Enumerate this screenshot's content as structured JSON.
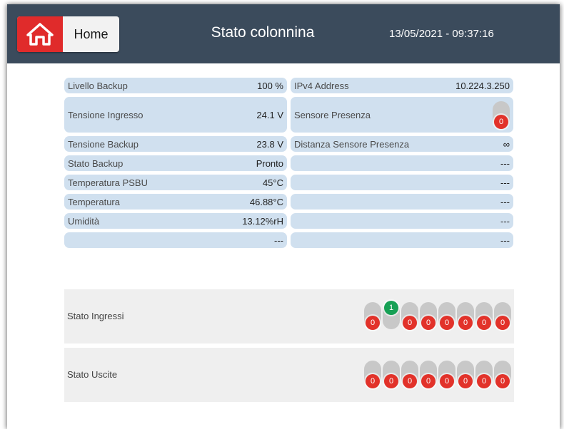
{
  "header": {
    "home_label": "Home",
    "title": "Stato colonnina",
    "datetime": "13/05/2021 - 09:37:16",
    "home_icon": "home-icon",
    "home_color": "#e02b2b",
    "header_color": "#3b4b5c"
  },
  "grid": {
    "rows": [
      {
        "left_label": "Livello Backup",
        "left_value": "100 %",
        "right_label": "IPv4 Address",
        "right_value": "10.224.3.250"
      },
      {
        "left_label": "Tensione Ingresso",
        "left_value": "24.1 V",
        "right_label": "Sensore Presenza",
        "right_value": "0"
      },
      {
        "left_label": "Tensione Backup",
        "left_value": "23.8 V",
        "right_label": "Distanza Sensore Presenza",
        "right_value": "∞"
      },
      {
        "left_label": "Stato Backup",
        "left_value": "Pronto",
        "right_label": "",
        "right_value": "---"
      },
      {
        "left_label": "Temperatura PSBU",
        "left_value": "45°C",
        "right_label": "",
        "right_value": "---"
      },
      {
        "left_label": "Temperatura",
        "left_value": "46.88°C",
        "right_label": "",
        "right_value": "---"
      },
      {
        "left_label": "Umidità",
        "left_value": "13.12%rH",
        "right_label": "",
        "right_value": "---"
      },
      {
        "left_label": "",
        "left_value": "---",
        "right_label": "",
        "right_value": "---"
      }
    ]
  },
  "inputs": {
    "label": "Stato Ingressi",
    "states": [
      "0",
      "1",
      "0",
      "0",
      "0",
      "0",
      "0",
      "0"
    ]
  },
  "outputs": {
    "label": "Stato Uscite",
    "states": [
      "0",
      "0",
      "0",
      "0",
      "0",
      "0",
      "0",
      "0"
    ]
  },
  "colors": {
    "cell_bg": "#d0e0ef",
    "off": "#e2322a",
    "on": "#17a055"
  }
}
